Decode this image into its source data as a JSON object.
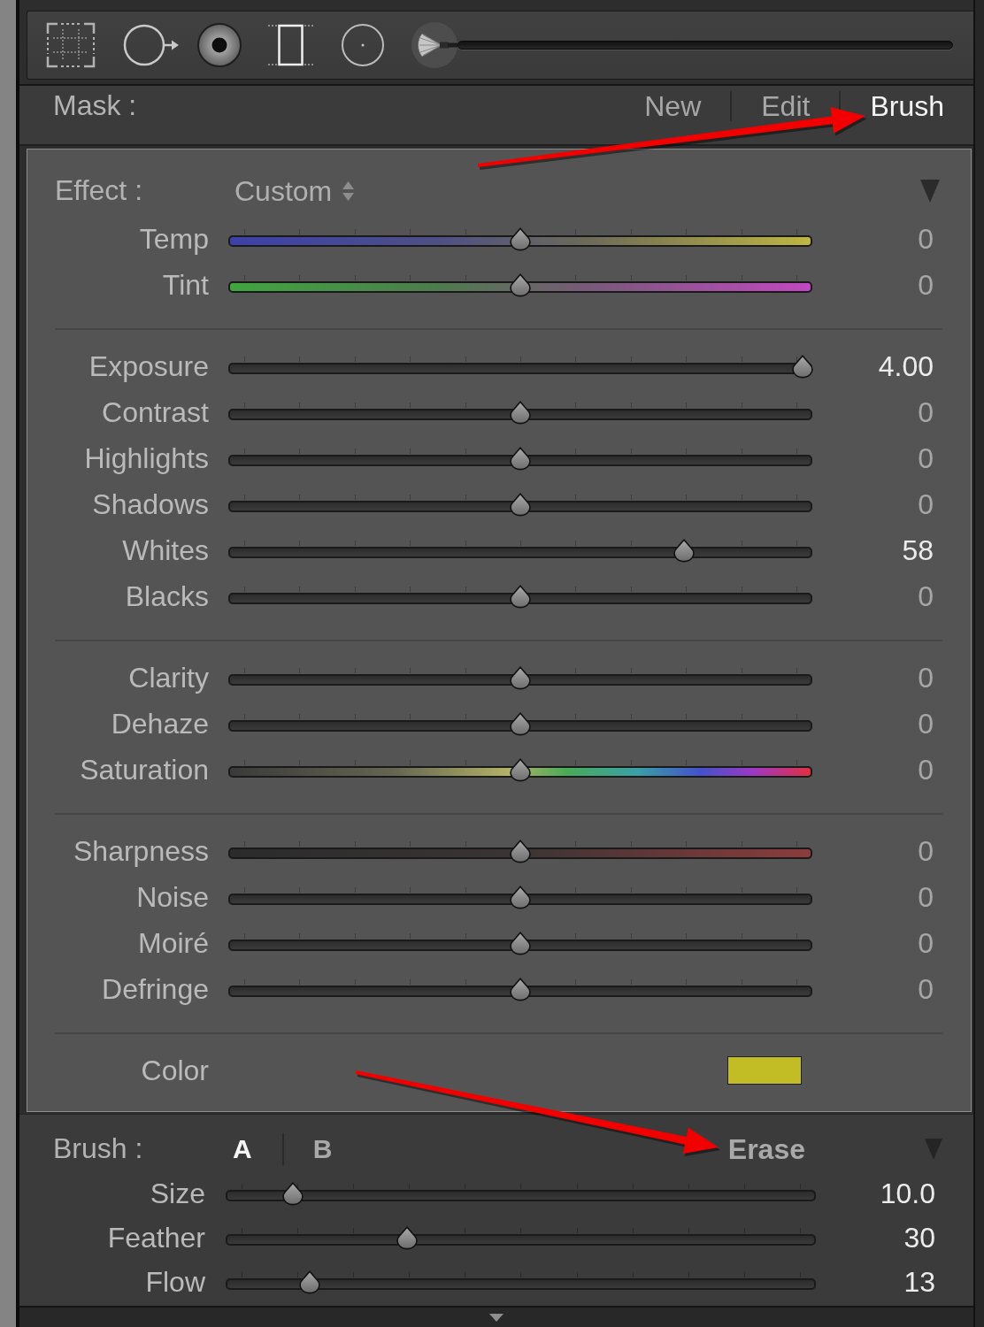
{
  "tool_strip": {
    "tools": [
      {
        "kind": "grid",
        "selected": false
      },
      {
        "kind": "spot",
        "selected": false
      },
      {
        "kind": "eye",
        "selected": false
      },
      {
        "kind": "gradient",
        "selected": false
      },
      {
        "kind": "radial",
        "selected": false
      },
      {
        "kind": "brush",
        "selected": true
      }
    ]
  },
  "mask": {
    "label": "Mask :",
    "tabs": [
      {
        "label": "New",
        "selected": false
      },
      {
        "label": "Edit",
        "selected": false
      },
      {
        "label": "Brush",
        "selected": true
      }
    ]
  },
  "effect": {
    "label": "Effect :",
    "preset": "Custom",
    "groups": [
      {
        "sliders": [
          {
            "label": "Temp",
            "kind": "temperature",
            "level": 0.5,
            "value": "0",
            "modified": false
          },
          {
            "label": "Tint",
            "kind": "tint",
            "level": 0.5,
            "value": "0",
            "modified": false
          }
        ]
      },
      {
        "sliders": [
          {
            "label": "Exposure",
            "kind": "plain",
            "level": 1,
            "value": "4.00",
            "modified": true
          },
          {
            "label": "Contrast",
            "kind": "plain",
            "level": 0.5,
            "value": "0",
            "modified": false
          },
          {
            "label": "Highlights",
            "kind": "plain",
            "level": 0.5,
            "value": "0",
            "modified": false
          },
          {
            "label": "Shadows",
            "kind": "plain",
            "level": 0.5,
            "value": "0",
            "modified": false
          },
          {
            "label": "Whites",
            "kind": "plain",
            "level": 0.79,
            "value": "58",
            "modified": true
          },
          {
            "label": "Blacks",
            "kind": "plain",
            "level": 0.5,
            "value": "0",
            "modified": false
          }
        ]
      },
      {
        "sliders": [
          {
            "label": "Clarity",
            "kind": "plain",
            "level": 0.5,
            "value": "0",
            "modified": false
          },
          {
            "label": "Dehaze",
            "kind": "plain",
            "level": 0.5,
            "value": "0",
            "modified": false
          },
          {
            "label": "Saturation",
            "kind": "hue",
            "level": 0.5,
            "value": "0",
            "modified": false
          }
        ]
      },
      {
        "sliders": [
          {
            "label": "Sharpness",
            "kind": "sharpen",
            "level": 0.5,
            "value": "0",
            "modified": false
          },
          {
            "label": "Noise",
            "kind": "plain",
            "level": 0.5,
            "value": "0",
            "modified": false
          },
          {
            "label": "Moiré",
            "kind": "plain",
            "level": 0.5,
            "value": "0",
            "modified": false
          },
          {
            "label": "Defringe",
            "kind": "plain",
            "level": 0.5,
            "value": "0",
            "modified": false
          }
        ]
      }
    ],
    "color": {
      "label": "Color",
      "color": "#c3bd25"
    }
  },
  "brush": {
    "label": "Brush :",
    "modes": [
      {
        "label": "A",
        "selected": true
      },
      {
        "label": "B",
        "selected": false
      }
    ],
    "erase": {
      "label": "Erase",
      "selected": false
    },
    "sliders": [
      {
        "label": "Size",
        "level": 0.1,
        "value": "10.0"
      },
      {
        "label": "Feather",
        "level": 0.3,
        "value": "30"
      },
      {
        "label": "Flow",
        "level": 0.13,
        "value": "13"
      }
    ]
  }
}
